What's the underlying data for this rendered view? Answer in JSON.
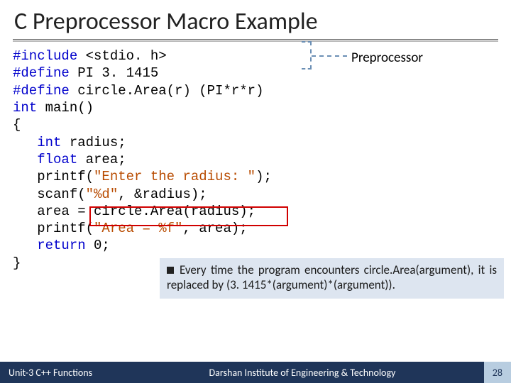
{
  "title": "C Preprocessor Macro Example",
  "code": {
    "l1a": "#include",
    "l1b": " <stdio. h>",
    "l2a": "#define",
    "l2b": " PI 3. 1415",
    "l3a": "#define",
    "l3b": " circle.Area(r) (PI*r*r)",
    "l4a": "int",
    "l4b": " main()",
    "l5": "{",
    "l6a": "   int",
    "l6b": " radius;",
    "l7a": "   float",
    "l7b": " area;",
    "l8a": "   printf(",
    "l8b": "\"Enter the radius: \"",
    "l8c": ");",
    "l9a": "   scanf(",
    "l9b": "\"%d\"",
    "l9c": ", &radius);",
    "l10": "   area = circle.Area(radius);",
    "l11a": "   printf(",
    "l11b": "\"Area = %f\"",
    "l11c": ", area);",
    "l12a": "   return",
    "l12b": " 0;",
    "l13": "}"
  },
  "annotation": {
    "label": "Preprocessor"
  },
  "note": "Every time the program encounters circle.Area(argument), it is replaced by (3. 1415*(argument)*(argument)).",
  "footer": {
    "left": "Unit-3 C++ Functions",
    "mid": "Darshan Institute of Engineering & Technology",
    "right": "28"
  }
}
